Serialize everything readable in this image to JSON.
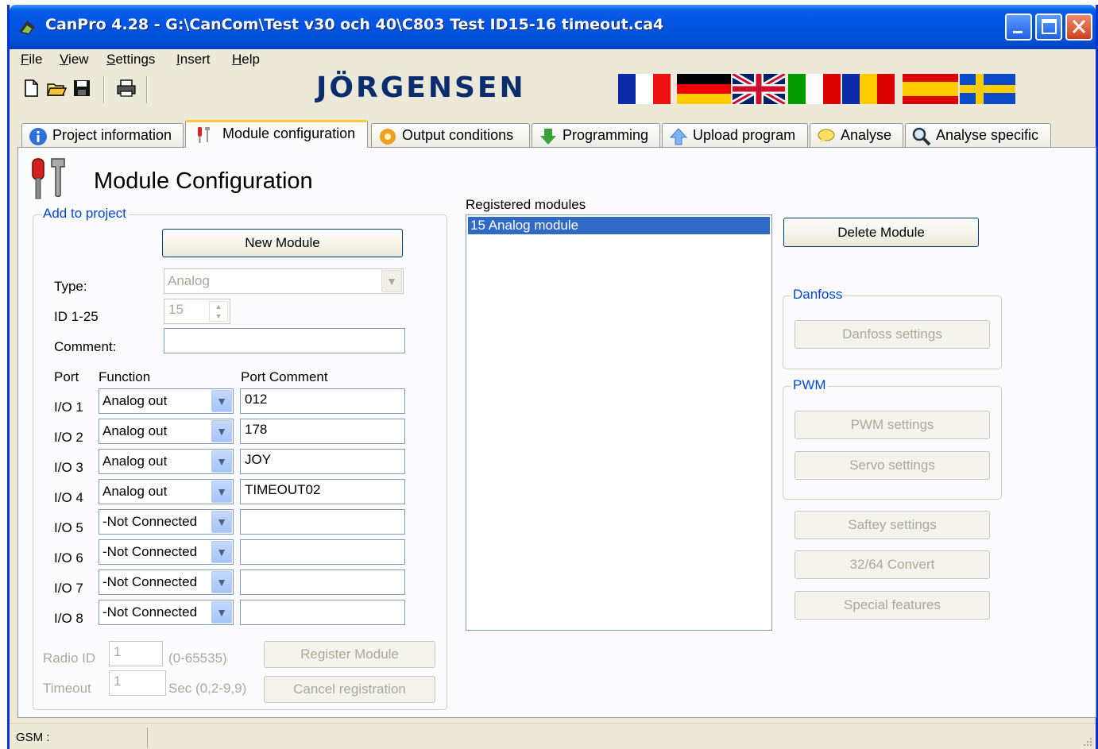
{
  "window": {
    "title": "CanPro 4.28 - G:\\CanCom\\Test v30 och 40\\C803 Test ID15-16 timeout.ca4"
  },
  "menu": {
    "items": [
      {
        "label": "File",
        "accel": "F",
        "rest": "ile"
      },
      {
        "label": "View",
        "accel": "V",
        "rest": "iew"
      },
      {
        "label": "Settings",
        "accel": "S",
        "rest": "ettings"
      },
      {
        "label": "Insert",
        "accel": "I",
        "rest": "nsert"
      },
      {
        "label": "Help",
        "accel": "H",
        "rest": "elp"
      }
    ]
  },
  "toolbar": {
    "icons": [
      "new-file-icon",
      "open-folder-icon",
      "save-icon",
      "print-icon"
    ],
    "logo": "JÖRGENSEN",
    "flags": [
      "france",
      "germany",
      "united-kingdom",
      "italy",
      "romania",
      "spain",
      "sweden"
    ]
  },
  "tabs": [
    {
      "label": "Project information",
      "icon": "info-icon"
    },
    {
      "label": "Module configuration",
      "icon": "tools-icon",
      "active": true
    },
    {
      "label": "Output conditions",
      "icon": "gear-icon"
    },
    {
      "label": "Programming",
      "icon": "down-arrow-icon"
    },
    {
      "label": "Upload program",
      "icon": "up-arrow-icon"
    },
    {
      "label": "Analyse",
      "icon": "speech-bubble-icon"
    },
    {
      "label": "Analyse specific",
      "icon": "magnifier-icon"
    }
  ],
  "page": {
    "title": "Module Configuration"
  },
  "add_group": {
    "label": "Add to project",
    "new_module_button": "New Module",
    "type_label": "Type:",
    "type_value": "Analog",
    "id_label": "ID  1-25",
    "id_value": "15",
    "comment_label": "Comment:",
    "comment_value": "",
    "col_port": "Port",
    "col_function": "Function",
    "col_comment": "Port Comment",
    "ports": [
      {
        "port": "I/O 1",
        "function": "Analog out",
        "comment": "012"
      },
      {
        "port": "I/O 2",
        "function": "Analog out",
        "comment": "178"
      },
      {
        "port": "I/O 3",
        "function": "Analog out",
        "comment": "JOY"
      },
      {
        "port": "I/O 4",
        "function": "Analog out",
        "comment": "TIMEOUT02"
      },
      {
        "port": "I/O 5",
        "function": "-Not Connected",
        "comment": ""
      },
      {
        "port": "I/O 6",
        "function": "-Not Connected",
        "comment": ""
      },
      {
        "port": "I/O 7",
        "function": "-Not Connected",
        "comment": ""
      },
      {
        "port": "I/O 8",
        "function": "-Not Connected",
        "comment": ""
      }
    ],
    "radio_id_label": "Radio ID",
    "radio_id_value": "1",
    "radio_id_range": "(0-65535)",
    "timeout_label": "Timeout",
    "timeout_value": "1",
    "timeout_range": "Sec (0,2-9,9)",
    "register_button": "Register Module",
    "cancel_button": "Cancel registration"
  },
  "registered": {
    "label": "Registered modules",
    "items": [
      "15  Analog module"
    ]
  },
  "right": {
    "delete_button": "Delete Module",
    "danfoss_group": "Danfoss",
    "danfoss_button": "Danfoss settings",
    "pwm_group": "PWM",
    "pwm_button": "PWM settings",
    "servo_button": "Servo settings",
    "safety_button": "Saftey settings",
    "convert_button": "32/64 Convert",
    "special_button": "Special features"
  },
  "status": {
    "gsm": "GSM :"
  }
}
